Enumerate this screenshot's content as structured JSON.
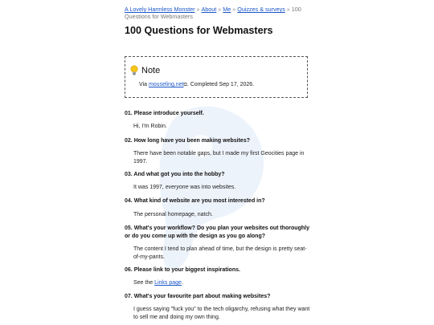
{
  "breadcrumb": {
    "items": [
      "A Lovely Harmless Monster",
      "About",
      "Me",
      "Quizzes & surveys"
    ],
    "current": "100 Questions for Webmasters",
    "separator": "»"
  },
  "page_title": "100 Questions for Webmasters",
  "note": {
    "heading": "Note",
    "via_prefix": "Via",
    "link_text": "mouseling.net",
    "completed_text": ". Completed Sep 17, 2026."
  },
  "qa": [
    {
      "num": "01.",
      "question": "Please introduce yourself.",
      "answer": "Hi, I'm Robin."
    },
    {
      "num": "02.",
      "question": "How long have you been making websites?",
      "answer": "There have been notable gaps, but I made my first Geocities page in 1997."
    },
    {
      "num": "03.",
      "question": "And what got you into the hobby?",
      "answer_before": "It was 1997, ",
      "answer_em": "everyone",
      "answer_after": " was into websites."
    },
    {
      "num": "04.",
      "question": "What kind of website are you most interested in?",
      "answer": "The personal homepage, natch."
    },
    {
      "num": "05.",
      "question": "What's your workflow? Do you plan your websites out thoroughly or do you come up with the design as you go along?",
      "answer": "The content I tend to plan ahead of time, but the design is pretty seat-of-my-pants."
    },
    {
      "num": "06.",
      "question": "Please link to your biggest inspirations.",
      "answer_before": "See the ",
      "answer_link": "Links page",
      "answer_after": "."
    },
    {
      "num": "07.",
      "question": "What's your favourite part about making websites?",
      "answer": "I guess saying \"fuck you\" to the tech oligarchy, refusing what they want to sell me and doing my own thing."
    }
  ],
  "colors": {
    "link": "#1a56c9",
    "deco": "#e9f1fb"
  }
}
